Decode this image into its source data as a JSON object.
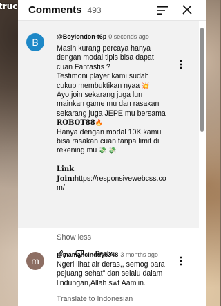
{
  "background": {
    "overlay_text": "truc"
  },
  "header": {
    "title": "Comments",
    "count": "493"
  },
  "comments": [
    {
      "avatar_letter": "B",
      "avatar_color": "#1e88c7",
      "author": "@Boylondon-t6p",
      "time": "0 seconds ago",
      "lines": [
        "Masih kurang percaya hanya",
        "dengan modal tipis bisa dapat",
        "cuan Fantastis ?",
        "Testimoni player kami sudah",
        "cukup membuktikan nyaa",
        "Ayo join sekarang juga lurr",
        "mainkan game mu dan rasakan",
        "sekarang juga JEPE mu bersama",
        "ROBOT88",
        "Hanya dengan modal 10K kamu",
        "bisa rasakan cuan tanpa limit di",
        "rekening mu",
        "Link",
        "Join:https://responsivewebcss.co",
        "m/"
      ],
      "emoji_collision": "💥",
      "emoji_fire": "🔥",
      "emoji_money": "💸 💸",
      "show_less": "Show less",
      "reply": "Reply"
    },
    {
      "avatar_letter": "m",
      "avatar_color": "#8d6e63",
      "author": "@mamahcinddy6348",
      "time": "3 months ago",
      "text": "Ngeri lihat air deras,, semog para pejuang sehat\" dan selalu dalam lindungan,Allah swt Aamiin.",
      "translate": "Translate to Indonesian"
    }
  ],
  "icons": {
    "sort": "sort-icon",
    "close": "close-icon",
    "more": "more-vert-icon",
    "like": "thumb-up-icon",
    "dislike": "thumb-down-icon"
  }
}
